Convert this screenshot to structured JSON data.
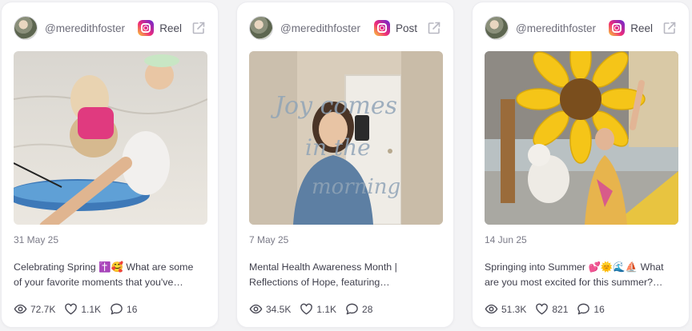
{
  "cards": [
    {
      "username": "@meredithfoster",
      "type": "Reel",
      "date": "31 May 25",
      "caption_line1": "Celebrating Spring ✝️🥰 What are some",
      "caption_line2": "of your favorite moments that you've…",
      "views": "72.7K",
      "likes": "1.1K",
      "comments": "16"
    },
    {
      "username": "@meredithfoster",
      "type": "Post",
      "date": "7 May 25",
      "caption_line1": "Mental Health Awareness Month |",
      "caption_line2": "Reflections of Hope, featuring…",
      "views": "34.5K",
      "likes": "1.1K",
      "comments": "28",
      "image_text": "Joy comes in the morning"
    },
    {
      "username": "@meredithfoster",
      "type": "Reel",
      "date": "14 Jun 25",
      "caption_line1": "Springing into Summer 💕🌞🌊⛵ What",
      "caption_line2": "are you most excited for this summer?…",
      "views": "51.3K",
      "likes": "821",
      "comments": "16"
    }
  ],
  "icons": {
    "platform": "instagram-icon",
    "external": "external-link-icon",
    "views": "eye-icon",
    "likes": "heart-icon",
    "comments": "comment-icon"
  },
  "colors": {
    "background": "#f3f3f5",
    "card": "#ffffff",
    "muted_text": "#7b7b88"
  }
}
